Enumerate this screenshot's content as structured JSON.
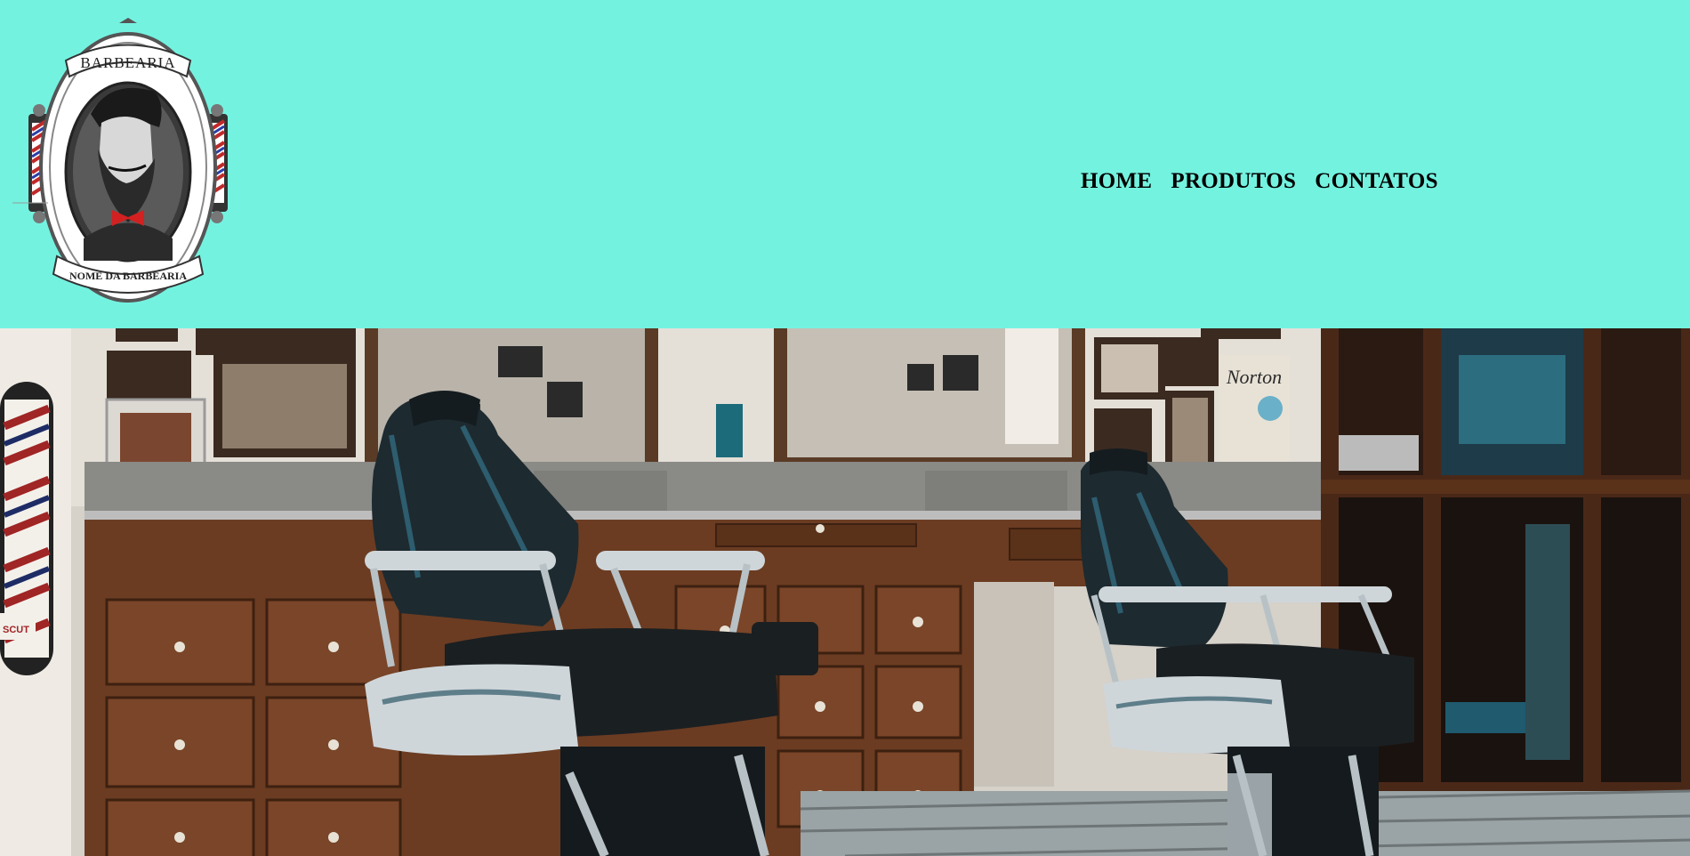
{
  "logo": {
    "top_text": "BARBEARIA",
    "bottom_text": "NOME DA BARBEARIA",
    "icon": "bearded-man-emblem"
  },
  "nav": {
    "items": [
      {
        "label": "HOME"
      },
      {
        "label": "PRODUTOS"
      },
      {
        "label": "CONTATOS"
      }
    ]
  },
  "hero": {
    "sign_text": "Norton",
    "pole_text": "SCUT"
  },
  "colors": {
    "header_bg": "#74f2e0",
    "wood": "#6b3c22",
    "leather": "#1d2a30",
    "chrome": "#cfd6da"
  }
}
